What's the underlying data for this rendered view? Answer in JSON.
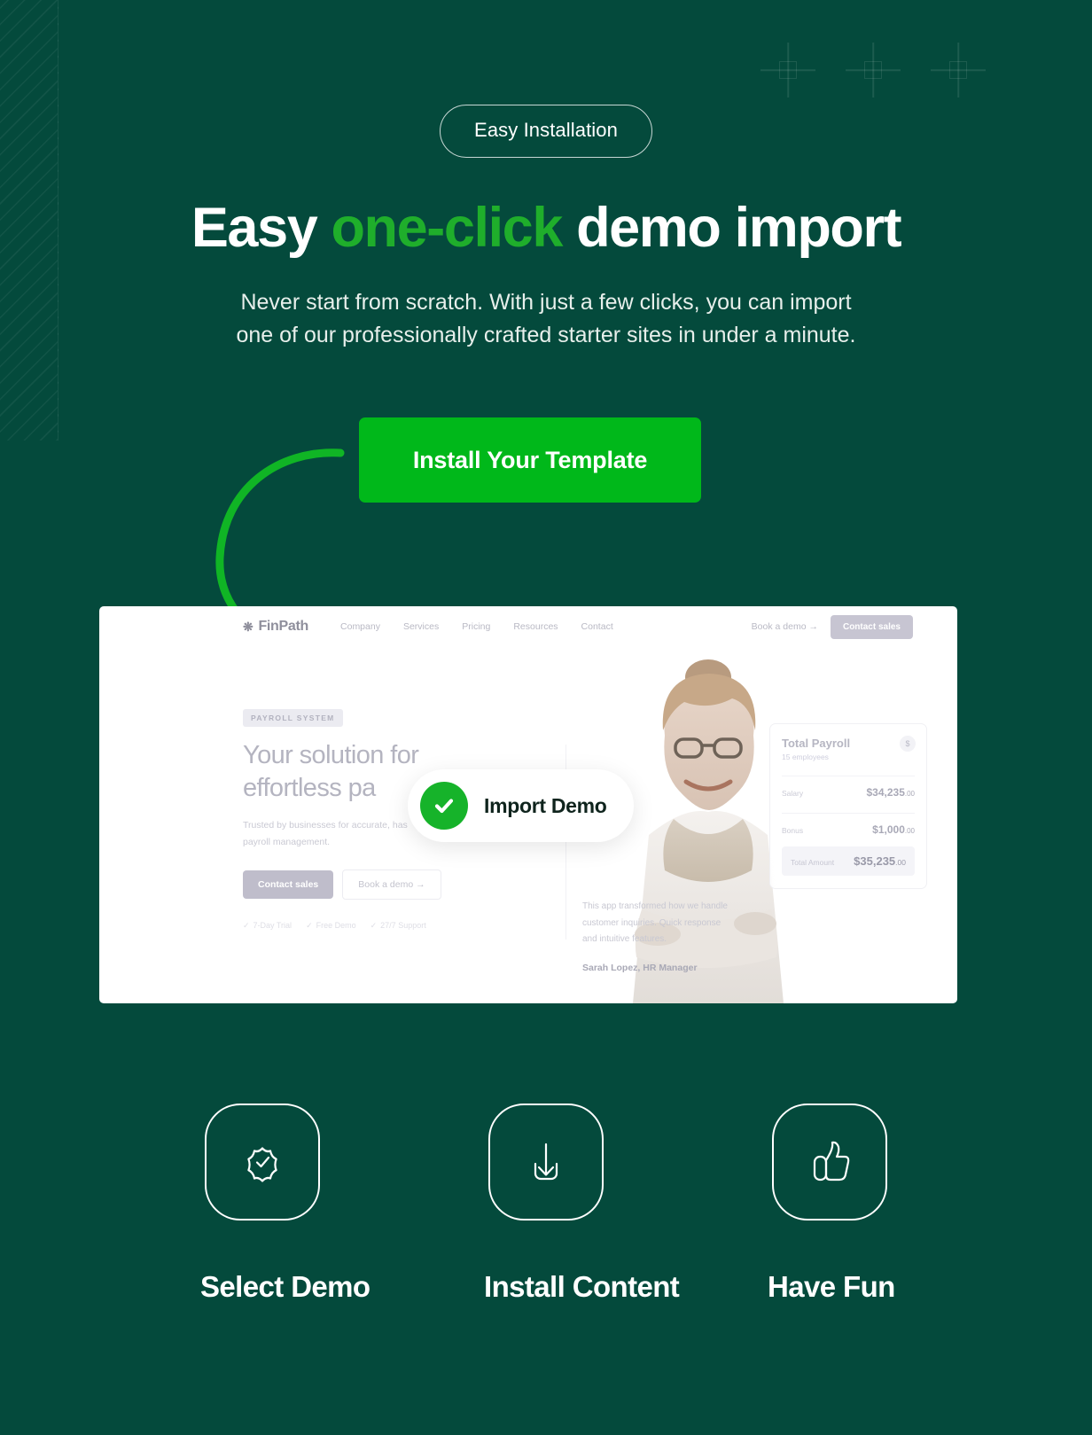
{
  "theme": {
    "background": "#044a3c",
    "accent_green": "#1fae2b",
    "button_green": "#00b81a",
    "text_white": "#ffffff"
  },
  "hero": {
    "badge": "Easy Installation",
    "headline_part1": "Easy ",
    "headline_accent": "one-click",
    "headline_part2": " demo import",
    "subcopy_line1": "Never start from scratch. With just a few clicks, you can import",
    "subcopy_line2": "one of our professionally crafted starter sites in under a minute.",
    "cta_label": "Install Your Template"
  },
  "mockup": {
    "nav": {
      "logo": "FinPath",
      "links": [
        "Company",
        "Services",
        "Pricing",
        "Resources",
        "Contact"
      ],
      "demo_link": "Book a demo  →",
      "sales_button": "Contact sales"
    },
    "hero": {
      "tag": "PAYROLL SYSTEM",
      "title_line1": "Your solution for",
      "title_line2": "effortless pa",
      "paragraph_line1": "Trusted by businesses for accurate, has",
      "paragraph_line2": "payroll management.",
      "primary_button": "Contact sales",
      "secondary_button": "Book a demo  →",
      "trust": [
        "7-Day Trial",
        "Free Demo",
        "27/7 Support"
      ]
    },
    "testimonial": {
      "quote_line1": "This app transformed how we handle",
      "quote_line2": "customer inquiries. Quick response",
      "quote_line3": "and intuitive features.",
      "author": "Sarah Lopez, HR Manager"
    },
    "payroll_card": {
      "title": "Total Payroll",
      "subtitle": "15 employees",
      "currency_symbol": "$",
      "rows": [
        {
          "label": "Salary",
          "amount": "$34,235",
          "cents": ".00"
        },
        {
          "label": "Bonus",
          "amount": "$1,000",
          "cents": ".00"
        }
      ],
      "total_label": "Total Amount",
      "total_amount": "$35,235",
      "total_cents": ".00"
    }
  },
  "floating_chip": {
    "label": "Import Demo",
    "icon": "check-circle-icon"
  },
  "steps": [
    {
      "icon": "badge-check-icon",
      "label": "Select Demo"
    },
    {
      "icon": "download-icon",
      "label": "Install Content"
    },
    {
      "icon": "thumbs-up-icon",
      "label": "Have Fun"
    }
  ]
}
